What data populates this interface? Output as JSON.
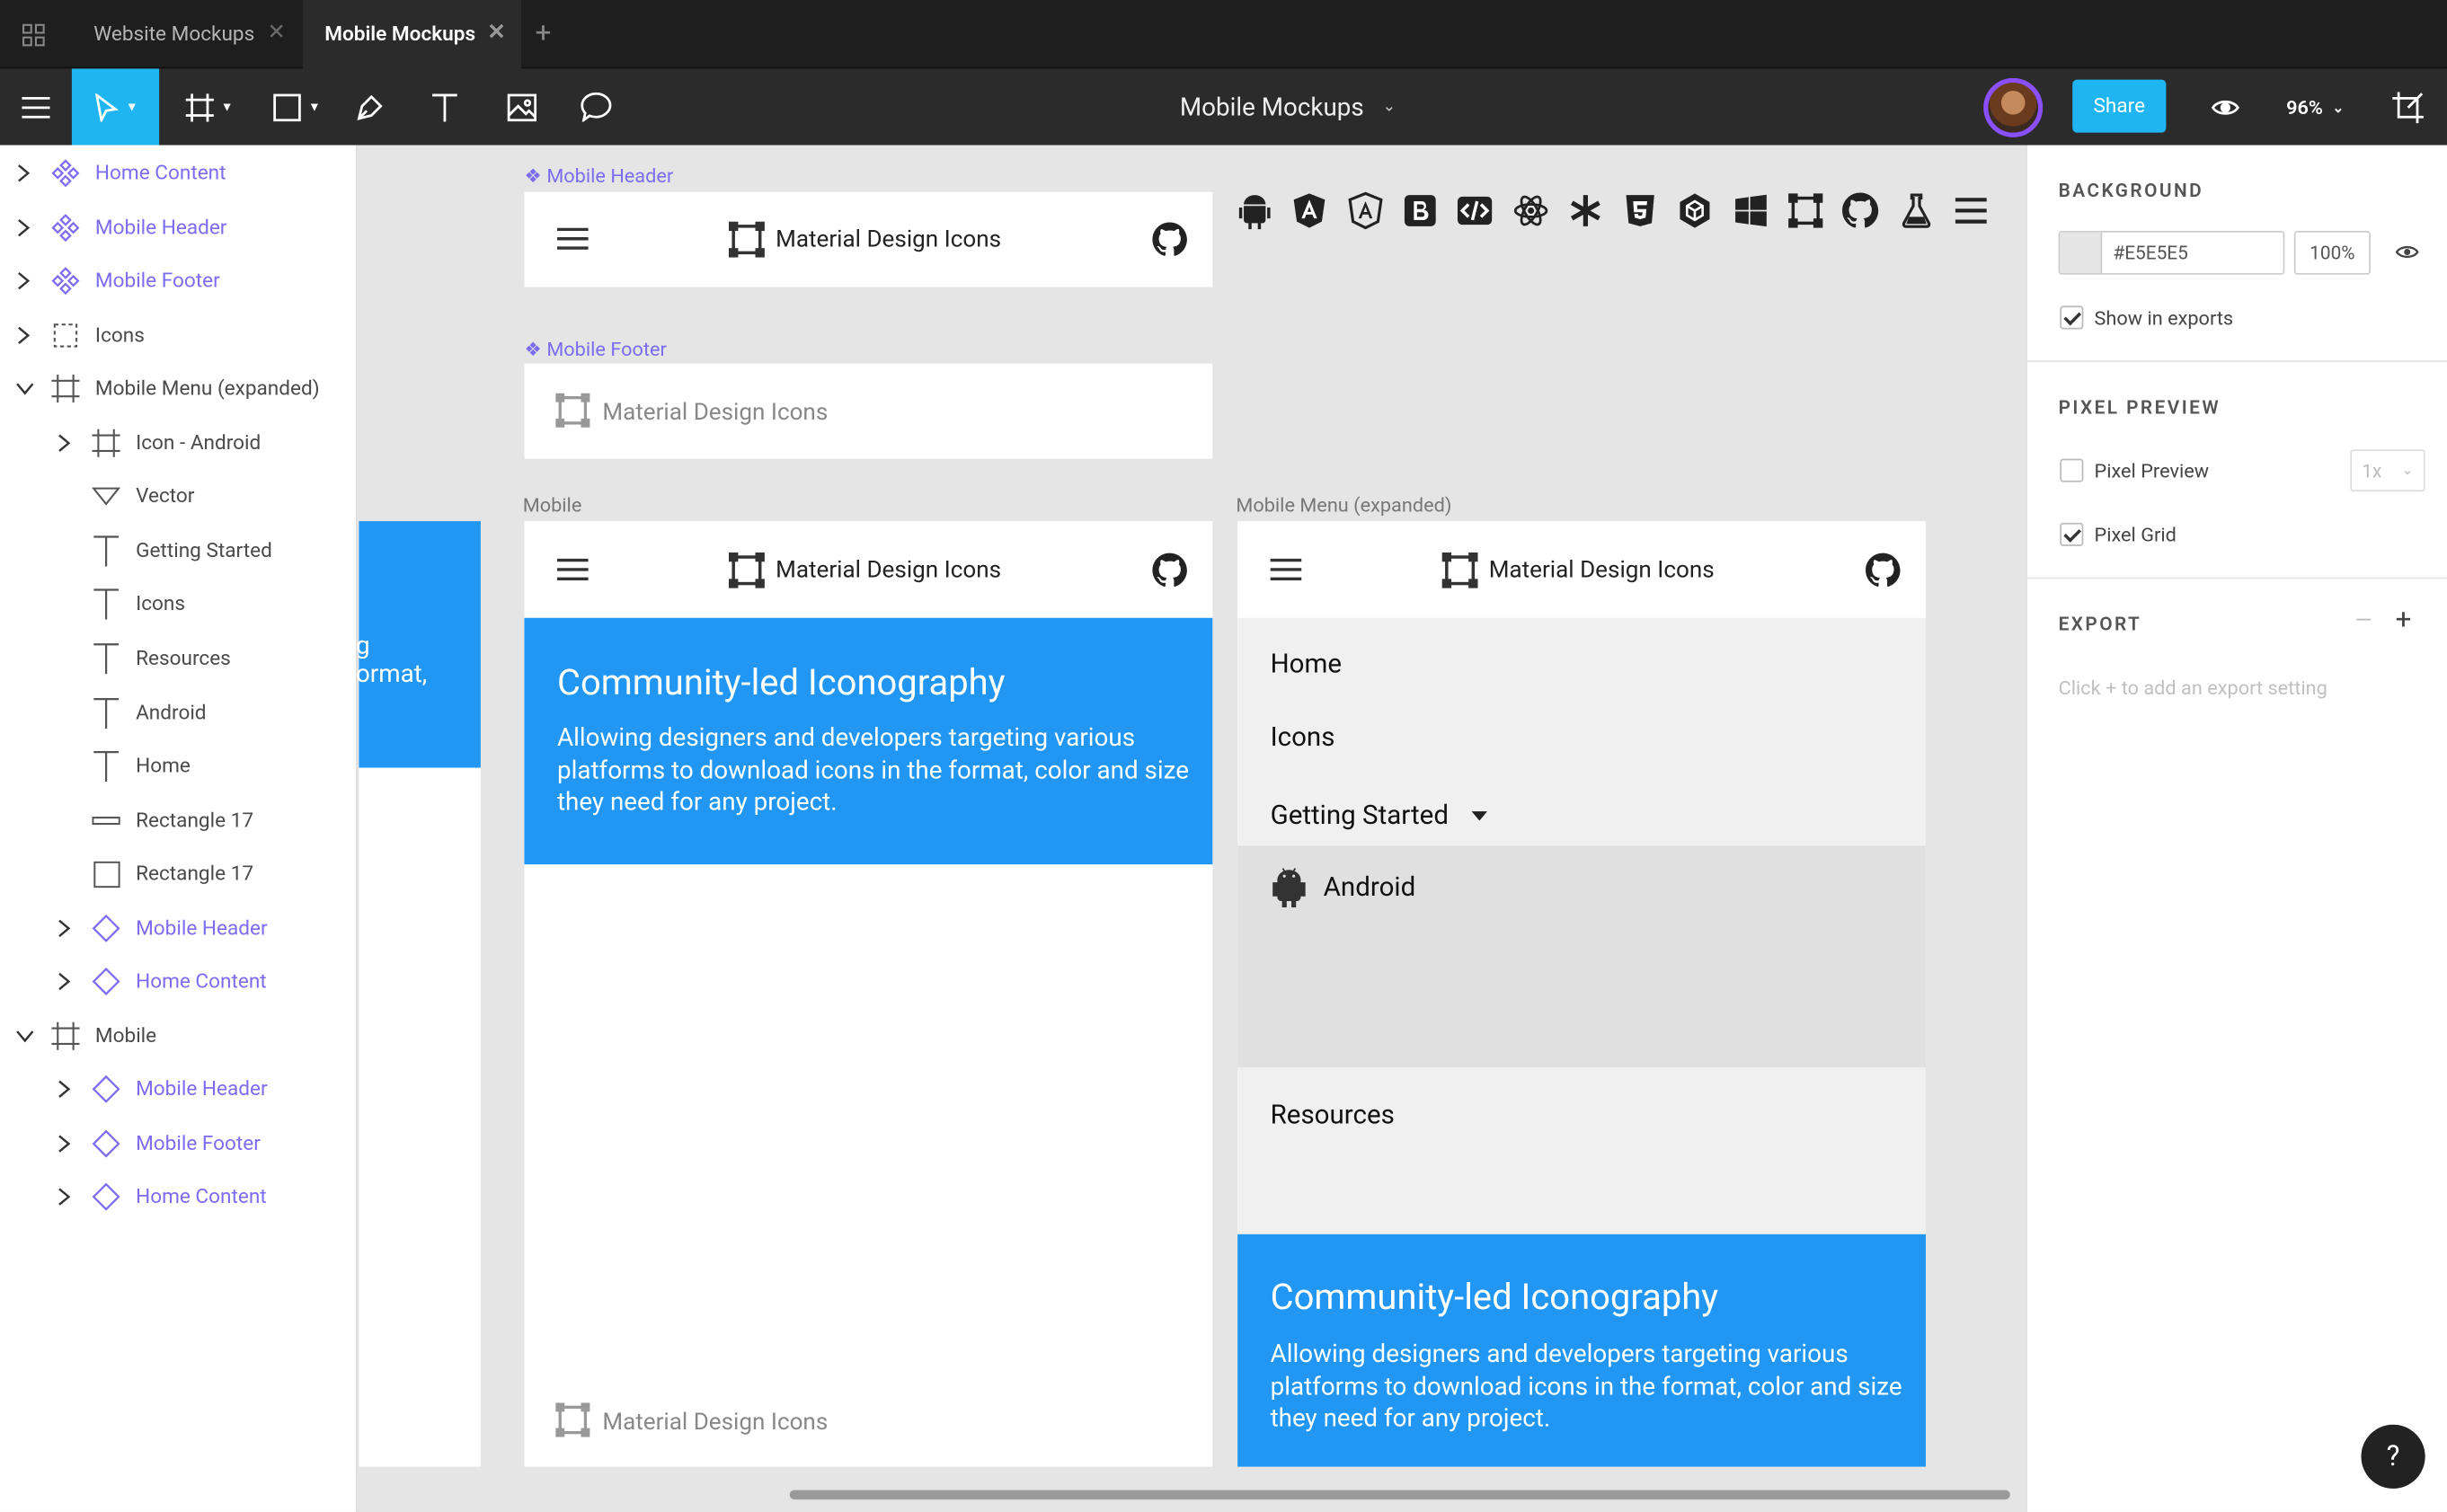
{
  "tabs": [
    {
      "label": "Website Mockups"
    },
    {
      "label": "Mobile Mockups"
    }
  ],
  "toolbar": {
    "document_title": "Mobile Mockups",
    "share_label": "Share",
    "zoom": "96%"
  },
  "layers": [
    {
      "name": "Home Content",
      "kind": "component",
      "depth": 0,
      "expanded": false
    },
    {
      "name": "Mobile Header",
      "kind": "component",
      "depth": 0,
      "expanded": false
    },
    {
      "name": "Mobile Footer",
      "kind": "component",
      "depth": 0,
      "expanded": false
    },
    {
      "name": "Icons",
      "kind": "group",
      "depth": 0,
      "expanded": false
    },
    {
      "name": "Mobile Menu (expanded)",
      "kind": "artboard",
      "depth": 0,
      "expanded": true
    },
    {
      "name": "Icon - Android",
      "kind": "artboard",
      "depth": 1,
      "expanded": false
    },
    {
      "name": "Vector",
      "kind": "vector",
      "depth": 1
    },
    {
      "name": "Getting Started",
      "kind": "text",
      "depth": 1
    },
    {
      "name": "Icons",
      "kind": "text",
      "depth": 1
    },
    {
      "name": "Resources",
      "kind": "text",
      "depth": 1
    },
    {
      "name": "Android",
      "kind": "text",
      "depth": 1
    },
    {
      "name": "Home",
      "kind": "text",
      "depth": 1
    },
    {
      "name": "Rectangle 17",
      "kind": "line-rect",
      "depth": 1
    },
    {
      "name": "Rectangle 17",
      "kind": "rect",
      "depth": 1
    },
    {
      "name": "Mobile Header",
      "kind": "instance",
      "depth": 1,
      "expanded": false
    },
    {
      "name": "Home Content",
      "kind": "instance",
      "depth": 1,
      "expanded": false
    },
    {
      "name": "Mobile",
      "kind": "artboard",
      "depth": 0,
      "expanded": true
    },
    {
      "name": "Mobile Header",
      "kind": "instance",
      "depth": 1,
      "expanded": false
    },
    {
      "name": "Mobile Footer",
      "kind": "instance",
      "depth": 1,
      "expanded": false
    },
    {
      "name": "Home Content",
      "kind": "instance",
      "depth": 1,
      "expanded": false
    }
  ],
  "canvas": {
    "header_component_label": "❖ Mobile Header",
    "footer_component_label": "❖ Mobile Footer",
    "mobile_label": "Mobile",
    "menu_label": "Mobile Menu (expanded)",
    "brand": "Material Design Icons",
    "hero_title": "Community-led Iconography",
    "hero_body": "Allowing designers and developers targeting various platforms to download icons in the format, color and size they need for any project.",
    "partial_left_1": "g",
    "partial_left_2": "ormat,",
    "menu": {
      "home": "Home",
      "icons": "Icons",
      "getting_started": "Getting Started",
      "android": "Android",
      "resources": "Resources"
    },
    "icon_strip": [
      "android-icon",
      "angular-icon",
      "angular-outline-icon",
      "bootstrap-icon",
      "code-icon",
      "react-icon",
      "asterisk-icon",
      "html5-icon",
      "cube-icon",
      "windows-icon",
      "vector-square-icon",
      "github-icon",
      "flask-icon",
      "menu-icon"
    ]
  },
  "props": {
    "background_title": "BACKGROUND",
    "bg_hex": "#E5E5E5",
    "bg_opacity": "100%",
    "show_in_exports": "Show in exports",
    "pixel_preview_title": "PIXEL PREVIEW",
    "pixel_preview": "Pixel Preview",
    "pixel_preview_scale": "1x",
    "pixel_grid": "Pixel Grid",
    "export_title": "EXPORT",
    "export_hint": "Click + to add an export setting"
  },
  "colors": {
    "accent": "#2196f3",
    "purple": "#7b6cf0",
    "canvas_bg": "#E5E5E5"
  }
}
